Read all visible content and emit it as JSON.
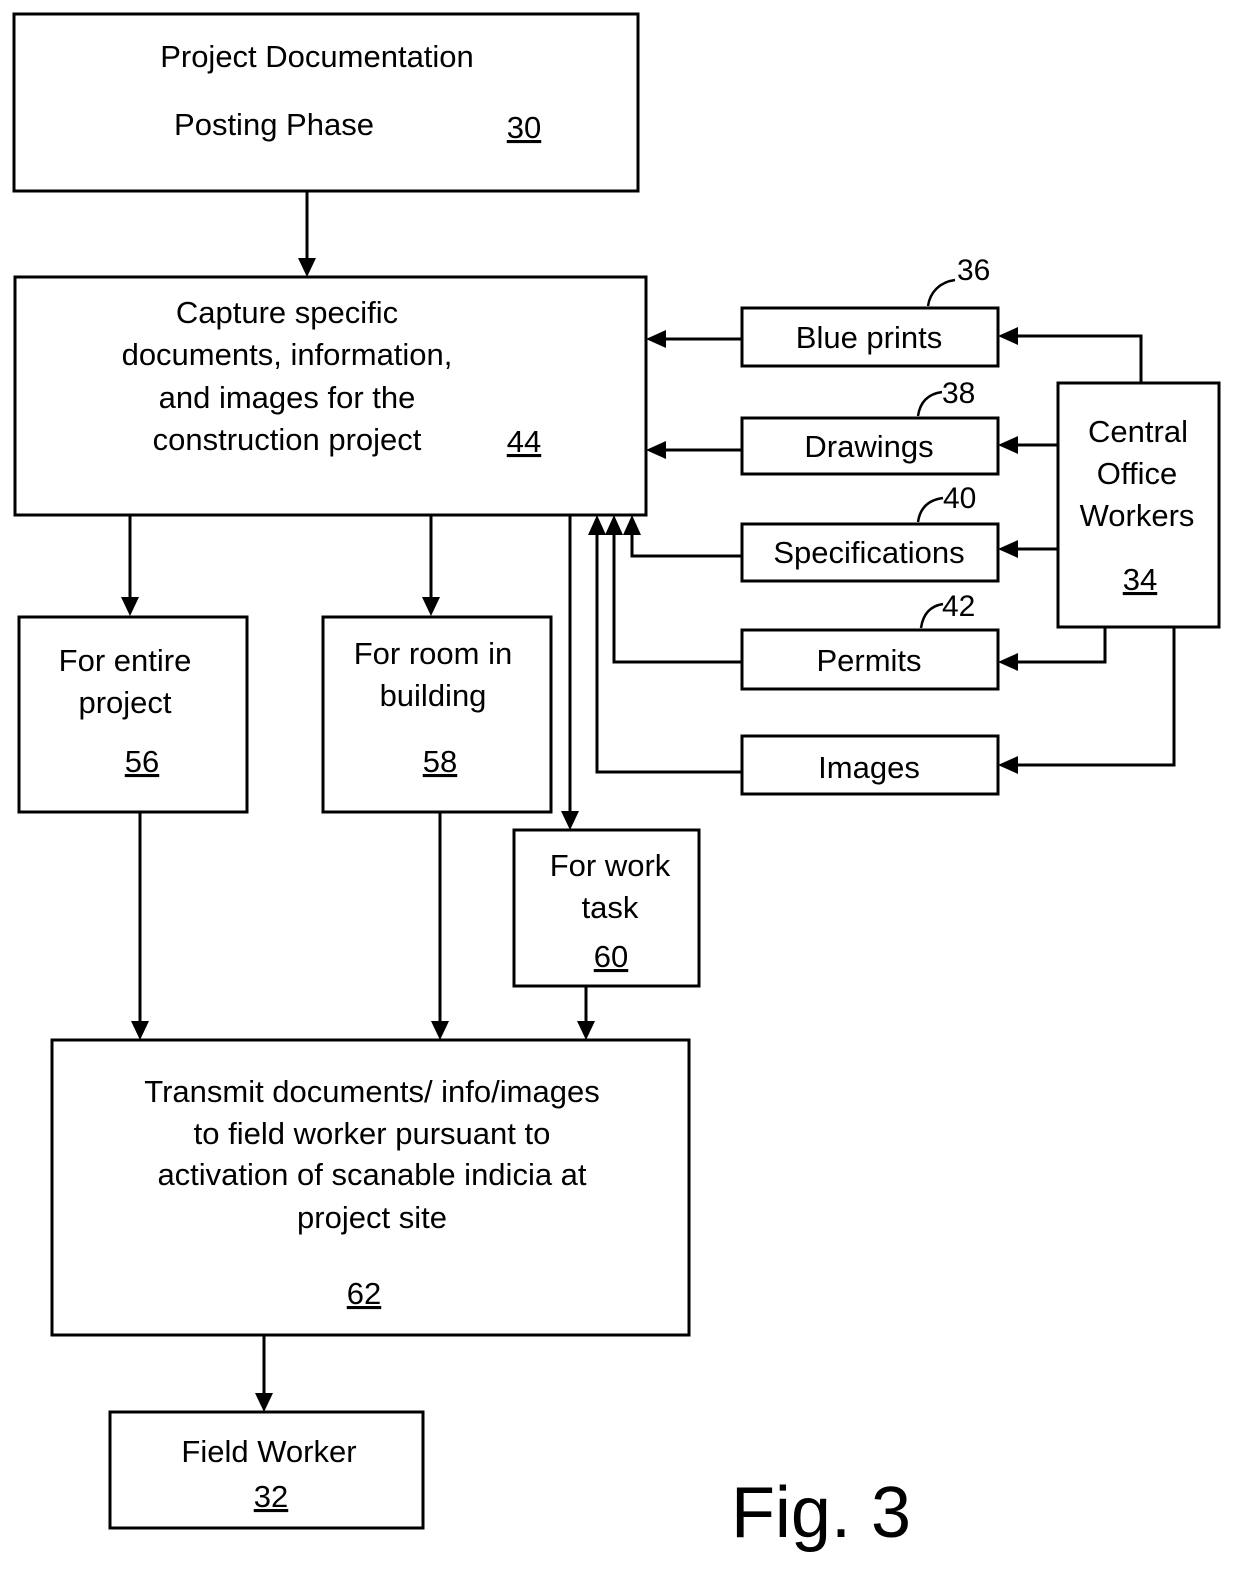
{
  "figure": {
    "label": "Fig. 3"
  },
  "colors": {
    "stroke": "#000000",
    "background": "#ffffff"
  },
  "boxes": {
    "posting": {
      "lines": [
        "Project Documentation",
        "Posting Phase"
      ],
      "ref": "30"
    },
    "capture": {
      "lines": [
        "Capture specific",
        "documents, information,",
        "and images for the",
        "construction project"
      ],
      "ref": "44"
    },
    "blueprints": {
      "label": "Blue prints",
      "callout": "36"
    },
    "drawings": {
      "label": "Drawings",
      "callout": "38"
    },
    "specifications": {
      "label": "Specifications",
      "callout": "40"
    },
    "permits": {
      "label": "Permits",
      "callout": "42"
    },
    "images": {
      "label": "Images"
    },
    "central": {
      "lines": [
        "Central",
        "Office",
        "Workers"
      ],
      "ref": "34"
    },
    "entire": {
      "lines": [
        "For entire",
        "project"
      ],
      "ref": "56"
    },
    "room": {
      "lines": [
        "For room in",
        "building"
      ],
      "ref": "58"
    },
    "task": {
      "lines": [
        "For work",
        "task"
      ],
      "ref": "60"
    },
    "transmit": {
      "lines": [
        "Transmit documents/ info/images",
        "to field worker pursuant to",
        "activation of scanable indicia at",
        "project site"
      ],
      "ref": "62"
    },
    "field": {
      "lines": [
        "Field Worker"
      ],
      "ref": "32"
    }
  }
}
